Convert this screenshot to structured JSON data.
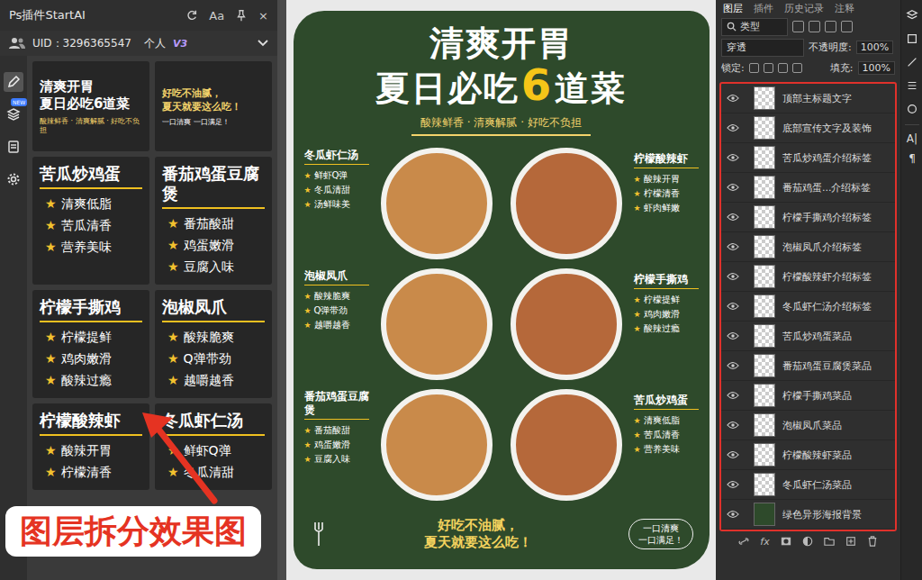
{
  "plugin": {
    "title": "Ps插件StartAI",
    "header_glyphs": [
      "Aa",
      "×"
    ],
    "uid": "UID：3296365547",
    "account": "个人",
    "version": "V3",
    "sidebar": [
      {
        "selected": true,
        "badge": ""
      },
      {
        "selected": false,
        "badge": "NEW"
      },
      {
        "selected": false,
        "badge": ""
      },
      {
        "selected": false,
        "badge": ""
      }
    ],
    "bullet": "★",
    "cards": [
      {
        "kind": "title",
        "lines": [
          "清爽开胃",
          "夏日必吃6道菜"
        ],
        "sub": "酸辣鲜香 · 清爽解腻 · 好吃不负担"
      },
      {
        "kind": "slogan",
        "lines": [
          "好吃不油腻，",
          "夏天就要这么吃！"
        ],
        "sub": "一口清爽 一口满足！"
      },
      {
        "kind": "dish",
        "name": "苦瓜炒鸡蛋",
        "points": [
          "清爽低脂",
          "苦瓜清香",
          "营养美味"
        ]
      },
      {
        "kind": "dish",
        "name": "番茄鸡蛋豆腐煲",
        "points": [
          "番茄酸甜",
          "鸡蛋嫩滑",
          "豆腐入味"
        ]
      },
      {
        "kind": "dish",
        "name": "柠檬手撕鸡",
        "points": [
          "柠檬提鲜",
          "鸡肉嫩滑",
          "酸辣过瘾"
        ]
      },
      {
        "kind": "dish",
        "name": "泡椒凤爪",
        "points": [
          "酸辣脆爽",
          "Q弹带劲",
          "越嚼越香"
        ]
      },
      {
        "kind": "dish",
        "name": "柠檬酸辣虾",
        "points": [
          "酸辣开胃",
          "柠檬清香"
        ]
      },
      {
        "kind": "dish",
        "name": "冬瓜虾仁汤",
        "points": [
          "鲜虾Q弹",
          "冬瓜清甜"
        ]
      }
    ]
  },
  "poster": {
    "title_line1": "清爽开胃",
    "title_line2": "夏日必吃",
    "title_number": "6",
    "title_suffix": "道菜",
    "subtitle": "酸辣鲜香 · 清爽解腻 · 好吃不负担",
    "bullet": "★",
    "rows": [
      {
        "left": {
          "name": "冬瓜虾仁汤",
          "points": [
            "鲜虾Q弹",
            "冬瓜清甜",
            "汤鲜味美"
          ]
        },
        "right": {
          "name": "柠檬酸辣虾",
          "points": [
            "酸辣开胃",
            "柠檬清香",
            "虾肉鲜嫩"
          ]
        }
      },
      {
        "left": {
          "name": "泡椒凤爪",
          "points": [
            "酸辣脆爽",
            "Q弹带劲",
            "越嚼越香"
          ]
        },
        "right": {
          "name": "柠檬手撕鸡",
          "points": [
            "柠檬提鲜",
            "鸡肉嫩滑",
            "酸辣过瘾"
          ]
        }
      },
      {
        "left": {
          "name": "番茄鸡蛋豆腐煲",
          "points": [
            "番茄酸甜",
            "鸡蛋嫩滑",
            "豆腐入味"
          ]
        },
        "right": {
          "name": "苦瓜炒鸡蛋",
          "points": [
            "清爽低脂",
            "苦瓜清香",
            "营养美味"
          ]
        }
      }
    ],
    "footer_lines": [
      "好吃不油腻，",
      "夏天就要这么吃！"
    ],
    "stamp": [
      "一口清爽",
      "一口满足！"
    ]
  },
  "layers": {
    "tabs": [
      {
        "label": "图层",
        "selected": true
      },
      {
        "label": "插件",
        "selected": false
      },
      {
        "label": "历史记录",
        "selected": false
      },
      {
        "label": "注释",
        "selected": false
      }
    ],
    "filter": "类型",
    "blend": "穿透",
    "opacity_label": "不透明度:",
    "opacity": "100%",
    "lock_label": "锁定:",
    "fill_label": "填充:",
    "fill": "100%",
    "items": [
      {
        "name": "顶部主标题文字",
        "visible": true,
        "kind": "layer"
      },
      {
        "name": "底部宣传文字及装饰",
        "visible": true,
        "kind": "layer"
      },
      {
        "name": "苦瓜炒鸡蛋介绍标签",
        "visible": true,
        "kind": "layer"
      },
      {
        "name": "番茄鸡蛋...介绍标签",
        "visible": true,
        "kind": "layer"
      },
      {
        "name": "柠檬手撕鸡介绍标签",
        "visible": true,
        "kind": "layer"
      },
      {
        "name": "泡椒凤爪介绍标签",
        "visible": true,
        "kind": "layer"
      },
      {
        "name": "柠檬酸辣虾介绍标签",
        "visible": true,
        "kind": "layer"
      },
      {
        "name": "冬瓜虾仁汤介绍标签",
        "visible": true,
        "kind": "layer"
      },
      {
        "name": "苦瓜炒鸡蛋菜品",
        "visible": true,
        "kind": "layer"
      },
      {
        "name": "番茄鸡蛋豆腐煲菜品",
        "visible": true,
        "kind": "layer"
      },
      {
        "name": "柠檬手撕鸡菜品",
        "visible": true,
        "kind": "layer"
      },
      {
        "name": "泡椒凤爪菜品",
        "visible": true,
        "kind": "layer"
      },
      {
        "name": "柠檬酸辣虾菜品",
        "visible": true,
        "kind": "layer"
      },
      {
        "name": "冬瓜虾仁汤菜品",
        "visible": true,
        "kind": "layer"
      },
      {
        "name": "绿色异形海报背景",
        "visible": true,
        "kind": "background"
      }
    ],
    "footer_fx": "fx"
  },
  "toolstrip": {
    "glyphs": [
      "A|",
      "¶"
    ]
  },
  "overlay": {
    "caption": "图层拆分效果图"
  }
}
